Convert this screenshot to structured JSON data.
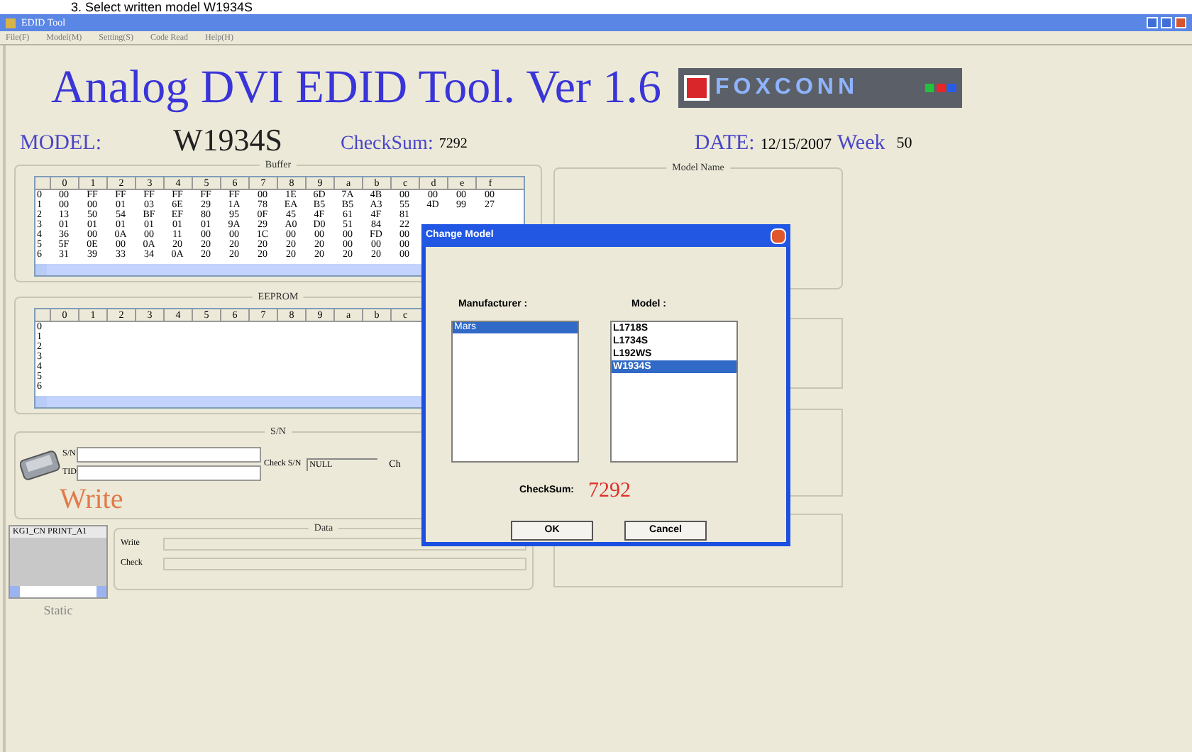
{
  "caption": "3. Select written model W1934S",
  "window": {
    "title": "EDID Tool"
  },
  "menu": [
    "File(F)",
    "Model(M)",
    "Setting(S)",
    "Code Read",
    "Help(H)"
  ],
  "app_title": "Analog DVI EDID Tool. Ver 1.6",
  "logo": {
    "text": "FOXCONN"
  },
  "model": {
    "label": "MODEL:",
    "value": "W1934S"
  },
  "checksum": {
    "label": "CheckSum:",
    "value": "7292"
  },
  "date": {
    "label": "DATE:",
    "value": "12/15/2007",
    "week_label": "Week",
    "week": "50"
  },
  "buffer": {
    "title": "Buffer",
    "columns": [
      "0",
      "1",
      "2",
      "3",
      "4",
      "5",
      "6",
      "7",
      "8",
      "9",
      "a",
      "b",
      "c",
      "d",
      "e",
      "f"
    ],
    "rows": [
      {
        "label": "0",
        "cells": [
          "00",
          "FF",
          "FF",
          "FF",
          "FF",
          "FF",
          "FF",
          "00",
          "1E",
          "6D",
          "7A",
          "4B",
          "00",
          "00",
          "00",
          "00"
        ]
      },
      {
        "label": "1",
        "cells": [
          "00",
          "00",
          "01",
          "03",
          "6E",
          "29",
          "1A",
          "78",
          "EA",
          "B5",
          "B5",
          "A3",
          "55",
          "4D",
          "99",
          "27"
        ]
      },
      {
        "label": "2",
        "cells": [
          "13",
          "50",
          "54",
          "BF",
          "EF",
          "80",
          "95",
          "0F",
          "45",
          "4F",
          "61",
          "4F",
          "81"
        ]
      },
      {
        "label": "3",
        "cells": [
          "01",
          "01",
          "01",
          "01",
          "01",
          "01",
          "9A",
          "29",
          "A0",
          "D0",
          "51",
          "84",
          "22"
        ]
      },
      {
        "label": "4",
        "cells": [
          "36",
          "00",
          "0A",
          "00",
          "11",
          "00",
          "00",
          "1C",
          "00",
          "00",
          "00",
          "FD",
          "00"
        ]
      },
      {
        "label": "5",
        "cells": [
          "5F",
          "0E",
          "00",
          "0A",
          "20",
          "20",
          "20",
          "20",
          "20",
          "20",
          "00",
          "00",
          "00"
        ]
      },
      {
        "label": "6",
        "cells": [
          "31",
          "39",
          "33",
          "34",
          "0A",
          "20",
          "20",
          "20",
          "20",
          "20",
          "20",
          "20",
          "00"
        ]
      }
    ]
  },
  "eeprom": {
    "title": "EEPROM",
    "columns": [
      "0",
      "1",
      "2",
      "3",
      "4",
      "5",
      "6",
      "7",
      "8",
      "9",
      "a",
      "b",
      "c"
    ],
    "rows": [
      "0",
      "1",
      "2",
      "3",
      "4",
      "5",
      "6"
    ]
  },
  "sn": {
    "title": "S/N",
    "sn_label": "S/N",
    "tid_label": "TID",
    "check_label": "Check S/N",
    "check_value": "NULL",
    "cut_label": "Ch",
    "write_label": "Write"
  },
  "status_list": {
    "header": "KG1_CN PRINT_A1",
    "caption": "Static"
  },
  "data": {
    "title": "Data",
    "write_label": "Write",
    "check_label": "Check"
  },
  "model_name": {
    "title": "Model Name"
  },
  "dialog": {
    "title": "Change Model",
    "manufacturer_label": "Manufacturer :",
    "manufacturers": [
      {
        "name": "Mars",
        "selected": true
      }
    ],
    "model_label": "Model :",
    "models": [
      {
        "name": "L1718S",
        "selected": false
      },
      {
        "name": "L1734S",
        "selected": false
      },
      {
        "name": "L192WS",
        "selected": false
      },
      {
        "name": "W1934S",
        "selected": true
      }
    ],
    "checksum_label": "CheckSum:",
    "checksum": "7292",
    "buttons": [
      "OK",
      "Cancel"
    ]
  }
}
